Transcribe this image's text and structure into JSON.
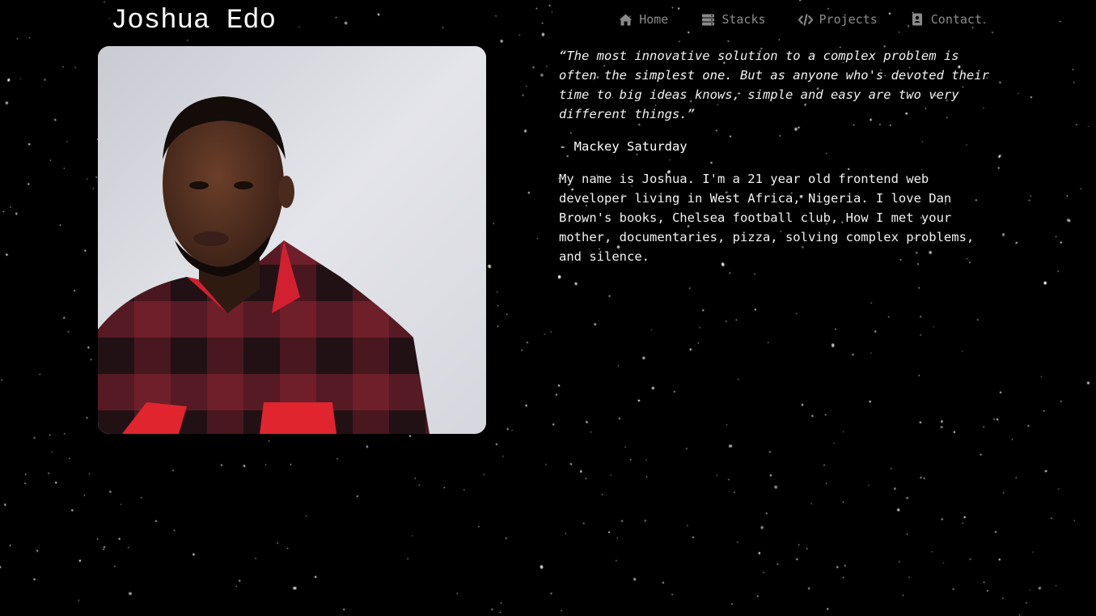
{
  "site": {
    "title": "Joshua Edo"
  },
  "nav": {
    "items": [
      {
        "label": "Home",
        "icon": "home-icon"
      },
      {
        "label": "Stacks",
        "icon": "stack-icon"
      },
      {
        "label": "Projects",
        "icon": "code-icon"
      },
      {
        "label": "Contact",
        "icon": "contact-book-icon"
      }
    ]
  },
  "profile": {
    "photo_alt": "Portrait photo"
  },
  "about": {
    "quote": "“The most innovative solution to a complex problem is often the simplest one. But as anyone who's devoted their time to big ideas knows, simple and easy are two very different things.”",
    "author": "- Mackey Saturday",
    "bio": "My name is Joshua. I'm a 21 year old frontend web developer living in West Africa, Nigeria. I love Dan Brown's books, Chelsea football club, How I met your mother, documentaries, pizza, solving complex problems, and silence."
  },
  "colors": {
    "background": "#000000",
    "text": "#ffffff",
    "nav_text": "#8a8a8a",
    "stars": "#ffffff"
  }
}
